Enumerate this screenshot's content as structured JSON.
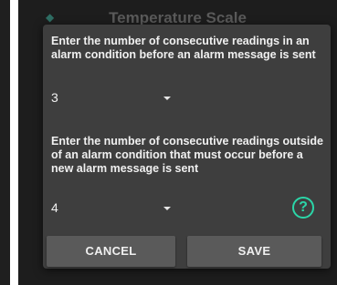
{
  "background": {
    "title": "Temperature Scale"
  },
  "dialog": {
    "question1": "Enter the number of consecutive readings in an alarm condition before an alarm message is sent",
    "select1_value": "3",
    "question2": "Enter the number of consecutive readings outside of an alarm condition that must occur before a new alarm message is sent",
    "select2_value": "4",
    "help_icon": "help-circle-icon",
    "help_glyph": "?",
    "cancel_label": "CANCEL",
    "save_label": "SAVE"
  },
  "colors": {
    "dialog_bg": "#3e3e3e",
    "screen_bg": "#1d1d1d",
    "accent": "#2bd6a8",
    "button_bg": "#5a5a5a"
  }
}
